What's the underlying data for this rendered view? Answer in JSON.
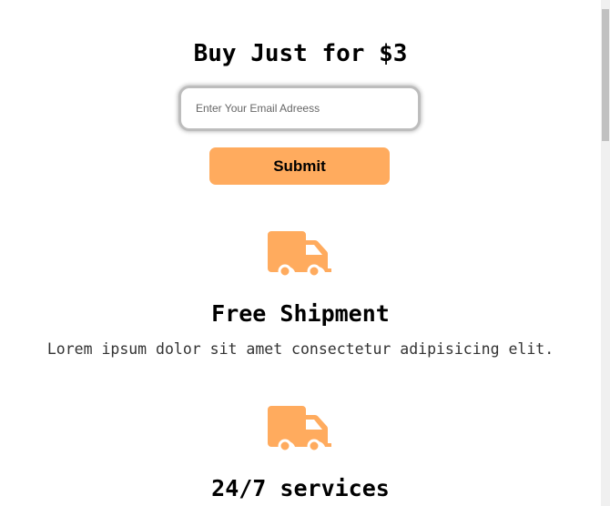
{
  "hero": {
    "title": "Buy Just for $3",
    "email_placeholder": "Enter Your Email Adreess",
    "email_value": "",
    "submit_label": "Submit"
  },
  "features": [
    {
      "icon": "truck-icon",
      "title": "Free Shipment",
      "description": "Lorem ipsum dolor sit amet consectetur adipisicing elit."
    },
    {
      "icon": "truck-icon",
      "title": "24/7 services",
      "description": ""
    }
  ],
  "colors": {
    "accent": "#ffab5e",
    "scrollbar_track": "#f0f0f0",
    "scrollbar_thumb": "#c1c1c1"
  }
}
